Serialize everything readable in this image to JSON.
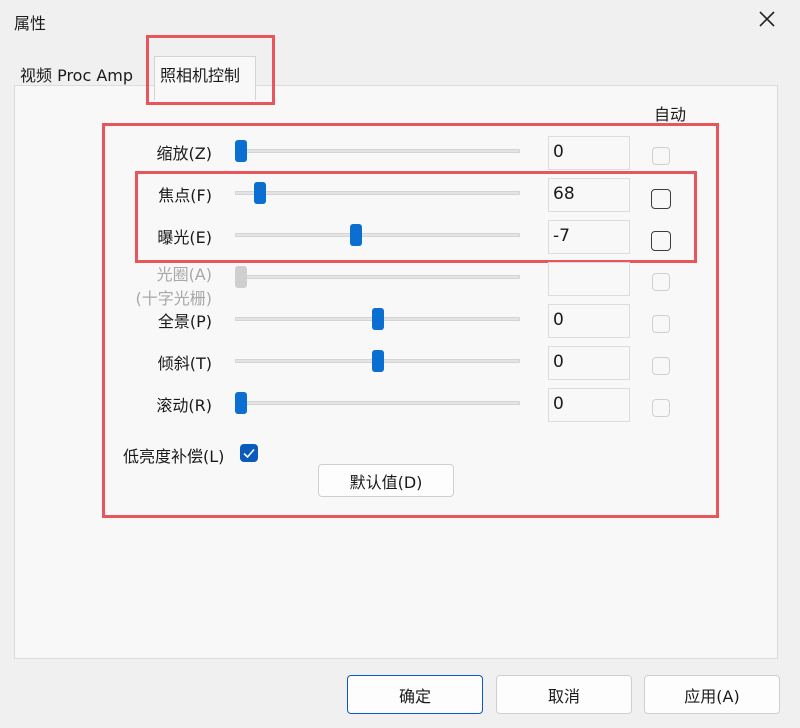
{
  "window": {
    "title": "属性"
  },
  "tabs": [
    {
      "label": "视频 Proc Amp"
    },
    {
      "label": "照相机控制"
    }
  ],
  "auto_header": "自动",
  "rows": [
    {
      "label": "缩放(Z)",
      "value": "0",
      "level": 0.0,
      "enabled": true
    },
    {
      "label": "焦点(F)",
      "value": "68",
      "level": 0.07,
      "enabled": true
    },
    {
      "label": "曝光(E)",
      "value": "-7",
      "level": 0.42,
      "enabled": true
    },
    {
      "label": "光圈(A)",
      "label2": "(十字光栅)",
      "value": "",
      "level": 0.0,
      "enabled": false
    },
    {
      "label": "全景(P)",
      "value": "0",
      "level": 0.5,
      "enabled": true
    },
    {
      "label": "倾斜(T)",
      "value": "0",
      "level": 0.5,
      "enabled": true
    },
    {
      "label": "滚动(R)",
      "value": "0",
      "level": 0.0,
      "enabled": true
    }
  ],
  "low_light": {
    "label": "低亮度补偿(L)",
    "checked": true
  },
  "default_button": "默认值(D)",
  "footer": {
    "ok": "确定",
    "cancel": "取消",
    "apply": "应用(A)"
  },
  "colors": {
    "accent": "#0a6fd1",
    "highlight": "#e8555a"
  }
}
